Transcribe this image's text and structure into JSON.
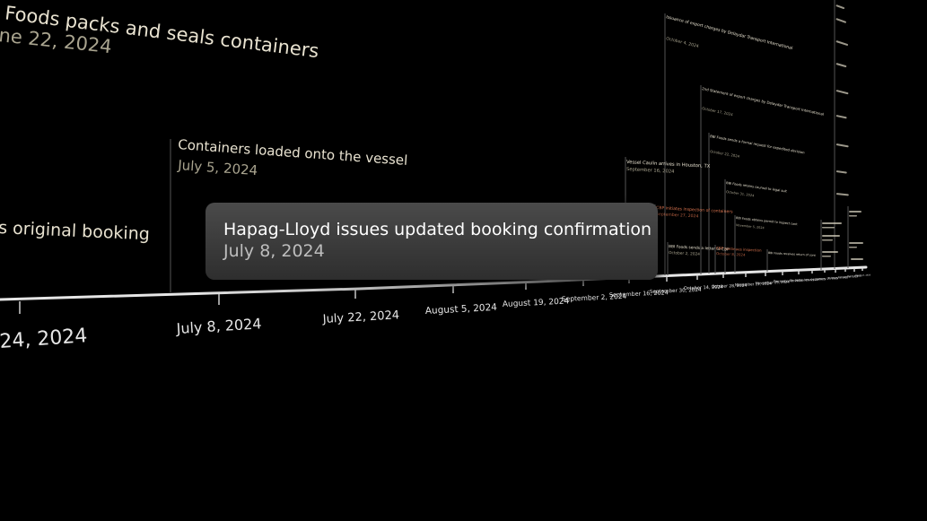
{
  "colors": {
    "background": "#000000",
    "event_text": "#e8e2d0",
    "event_date": "#a9a48f",
    "highlight": "#d9734e",
    "axis": "#e6e6e6",
    "popup_title": "#ffffff",
    "popup_date": "#bdbdbd"
  },
  "popup": {
    "title": "Hapag-Lloyd issues updated booking confirmation",
    "date": "July 8, 2024"
  },
  "events": {
    "packs": {
      "title": "Bi Foods packs and seals containers",
      "date": "ne 22, 2024"
    },
    "booking": {
      "title": "s original booking"
    },
    "loaded": {
      "title": "Containers loaded onto the vessel",
      "date": "July 5, 2024"
    },
    "vessel_houston": {
      "title": "Vessel Caulin arrives in Houston, TX",
      "date": "September 16, 2024"
    },
    "cbp_inspection": {
      "title": "CBP initiates inspection of containers",
      "date": "September 27, 2024"
    },
    "bbi_letter": {
      "title": "BBI Foods sends a letter to CBP",
      "date": "October 2, 2024"
    },
    "cbp_continues": {
      "title": "CBP continues inspection",
      "date": "October 8, 2024"
    },
    "issuance_1": {
      "title": "Issuance of export charges by Delaydar Transport International",
      "date": "October 4, 2024"
    },
    "issuance_2": {
      "title": "2nd Statement of export charges by Delaydar Transport International",
      "date": "October 17, 2024"
    },
    "bbi_notice": {
      "title": "BBI Foods sends a formal request for expedited decision",
      "date": "October 22, 2024"
    },
    "bbi_legal": {
      "title": "BBI Foods retains counsel to legal suit",
      "date": "October 31, 2024"
    },
    "bbi_permit": {
      "title": "BBI Foods obtains permit to inspect cont",
      "date": "November 5, 2024"
    },
    "bbi_return": {
      "title": "BBI Foods receives return of cont",
      "date": ""
    }
  },
  "axis_labels": {
    "l0": "24, 2024",
    "l1": "July 8, 2024",
    "l2": "July 22, 2024",
    "l3": "August 5, 2024",
    "l4": "August 19, 2024",
    "l5": "September 2, 2024",
    "l6": "September 16, 2024",
    "l7": "September 30, 2024",
    "l8": "October 14, 2024",
    "l9": "October 28, 2024",
    "l10": "November 11, 2024",
    "l11": "November 25, 2024",
    "l12": "December 9, 2024",
    "l13": "December 23, 2024",
    "l14": "January 6, 2025",
    "l15": "January 20, 2025",
    "l16": "February 3, 2025",
    "l17": "February 17, 2025",
    "l18": "March 3, 2025",
    "l19": "March 17, 2025"
  }
}
